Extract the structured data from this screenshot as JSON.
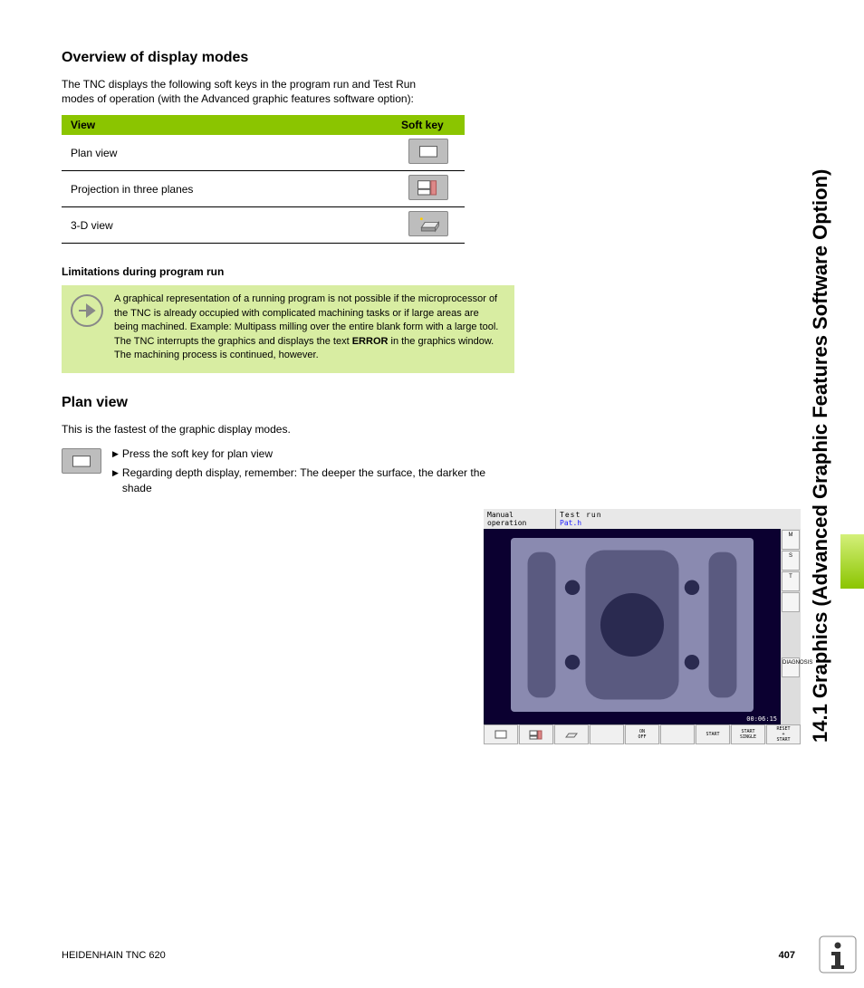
{
  "sideTitle": "14.1 Graphics (Advanced Graphic Features Software Option)",
  "heading1": "Overview of display modes",
  "intro": "The TNC displays the following soft keys in the program run and Test Run modes of operation (with the Advanced graphic features software option):",
  "table": {
    "col1": "View",
    "col2": "Soft key",
    "rows": [
      {
        "view": "Plan view"
      },
      {
        "view": "Projection in three planes"
      },
      {
        "view": "3-D view"
      }
    ]
  },
  "subheading": "Limitations during program run",
  "note": {
    "text1": "A graphical representation of a running program is not possible if the microprocessor of the TNC is already occupied with complicated machining tasks or if large areas are being machined. Example: Multipass milling over the entire blank form with a large tool. The TNC interrupts the graphics and displays the text ",
    "error": "ERROR",
    "text2": " in the graphics window. The machining process is continued, however."
  },
  "heading2": "Plan view",
  "planIntro": "This is the fastest of the graphic display modes.",
  "planItems": [
    "Press the soft key for plan view",
    "Regarding depth display, remember: The deeper the surface, the darker the shade"
  ],
  "screenshot": {
    "mode": "Manual operation",
    "title": "Test run",
    "file": "Pat.h",
    "time": "00:06:15",
    "sideLabels": [
      "M",
      "S",
      "T",
      "",
      "DIAGNOSIS"
    ],
    "bottomLabels": [
      "",
      "",
      "",
      "",
      "ON\nOFF",
      "",
      "START",
      "START\nSINGLE",
      "RESET\n+\nSTART"
    ]
  },
  "footer": {
    "left": "HEIDENHAIN TNC 620",
    "page": "407"
  }
}
